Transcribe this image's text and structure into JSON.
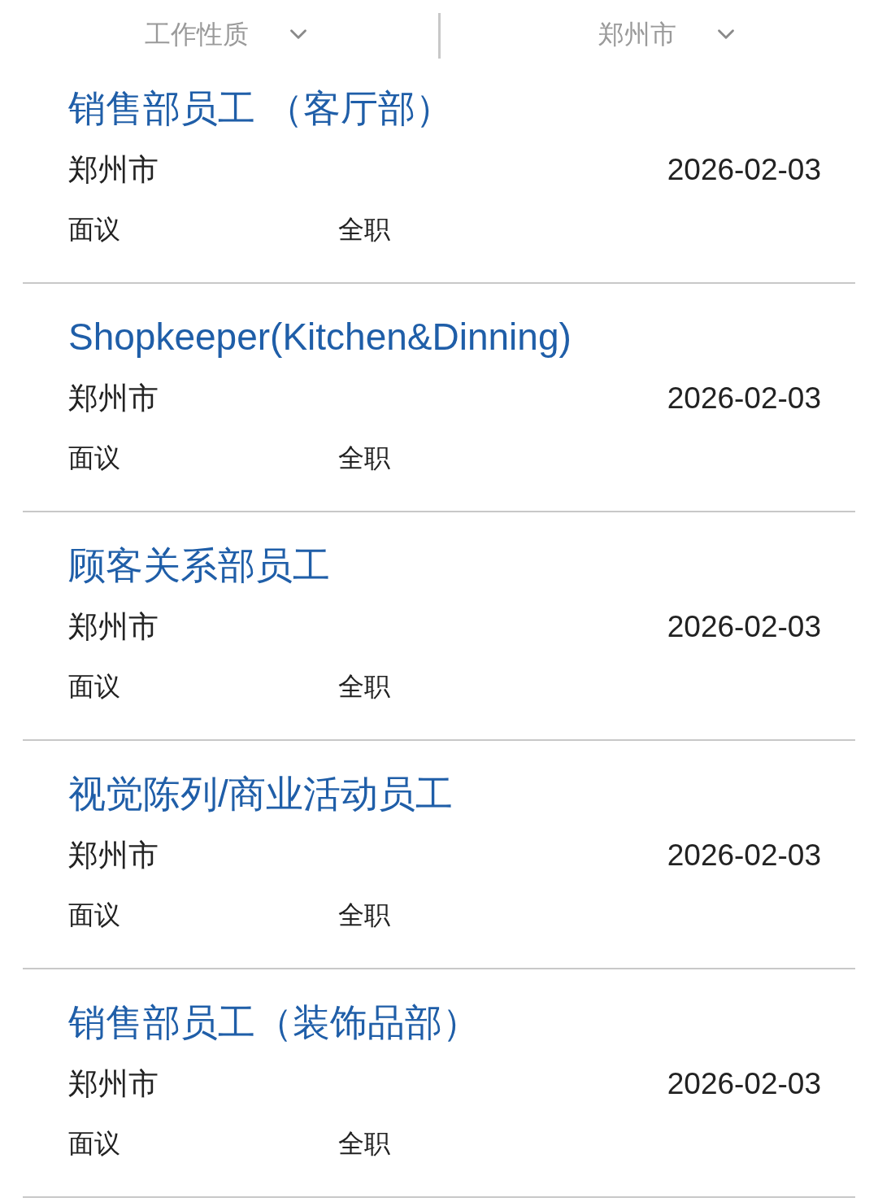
{
  "filters": [
    {
      "label": "工作性质"
    },
    {
      "label": "郑州市"
    }
  ],
  "jobs": [
    {
      "title": "销售部员工 （客厅部）",
      "city": "郑州市",
      "date": "2026-02-03",
      "salary": "面议",
      "type": "全职"
    },
    {
      "title": "Shopkeeper(Kitchen&Dinning)",
      "city": "郑州市",
      "date": "2026-02-03",
      "salary": "面议",
      "type": "全职"
    },
    {
      "title": "顾客关系部员工",
      "city": "郑州市",
      "date": "2026-02-03",
      "salary": "面议",
      "type": "全职"
    },
    {
      "title": "视觉陈列/商业活动员工",
      "city": "郑州市",
      "date": "2026-02-03",
      "salary": "面议",
      "type": "全职"
    },
    {
      "title": "销售部员工（装饰品部）",
      "city": "郑州市",
      "date": "2026-02-03",
      "salary": "面议",
      "type": "全职"
    }
  ]
}
